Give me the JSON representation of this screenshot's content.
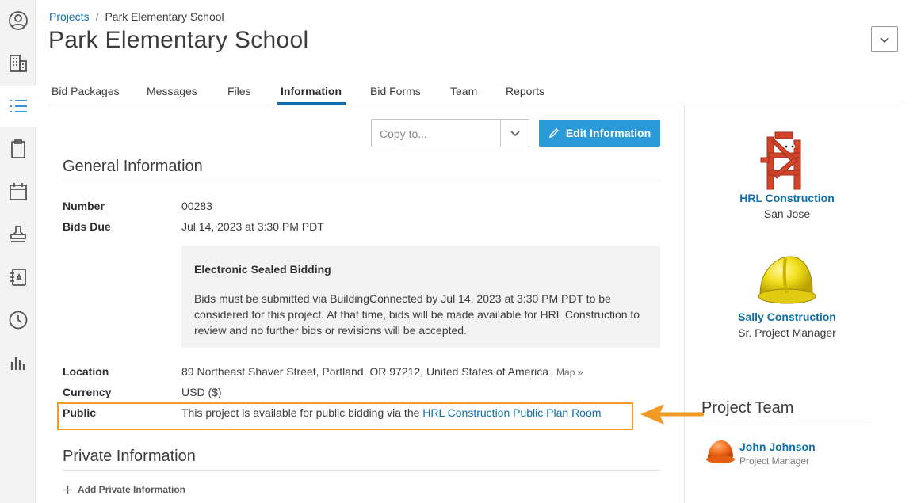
{
  "breadcrumb": {
    "root": "Projects",
    "separator": "/",
    "current": "Park Elementary School"
  },
  "page": {
    "title": "Park Elementary School"
  },
  "sidebar": {
    "items": [
      {
        "icon": "user-circle-icon"
      },
      {
        "icon": "building-icon"
      },
      {
        "icon": "list-icon",
        "active": true
      },
      {
        "icon": "clipboard-icon"
      },
      {
        "icon": "calendar-icon"
      },
      {
        "icon": "stamp-icon"
      },
      {
        "icon": "address-book-icon"
      },
      {
        "icon": "clock-icon"
      },
      {
        "icon": "bar-chart-icon"
      }
    ]
  },
  "tabs": [
    {
      "label": "Bid Packages"
    },
    {
      "label": "Messages"
    },
    {
      "label": "Files"
    },
    {
      "label": "Information",
      "active": true
    },
    {
      "label": "Bid Forms"
    },
    {
      "label": "Team"
    },
    {
      "label": "Reports"
    }
  ],
  "toolbar": {
    "copy_placeholder": "Copy to...",
    "edit_label": "Edit Information"
  },
  "general": {
    "title": "General Information",
    "number_label": "Number",
    "number_value": "00283",
    "bids_due_label": "Bids Due",
    "bids_due_value": "Jul 14, 2023 at 3:30 PM PDT",
    "sealed_title": "Electronic Sealed Bidding",
    "sealed_text": "Bids must be submitted via BuildingConnected by Jul 14, 2023 at 3:30 PM PDT to be considered for this project. At that time, bids will be made available for HRL Construction to review and no further bids or revisions will be accepted.",
    "location_label": "Location",
    "location_value": "89 Northeast Shaver Street, Portland, OR 97212, United States of America",
    "map_link": "Map »",
    "currency_label": "Currency",
    "currency_value": "USD ($)",
    "public_label": "Public",
    "public_text": "This project is available for public bidding via the",
    "public_link": "HRL Construction Public Plan Room"
  },
  "private": {
    "title": "Private Information",
    "add_label": "Add Private Information"
  },
  "companies": [
    {
      "name": "HRL Construction",
      "subtitle": "San Jose"
    },
    {
      "name": "Sally Construction",
      "subtitle": "Sr. Project Manager"
    }
  ],
  "team": {
    "title": "Project Team",
    "members": [
      {
        "name": "John Johnson",
        "role": "Project Manager"
      }
    ]
  },
  "colors": {
    "accent": "#2a9ad8",
    "link": "#0f6fa8",
    "highlight": "#f39a26"
  }
}
